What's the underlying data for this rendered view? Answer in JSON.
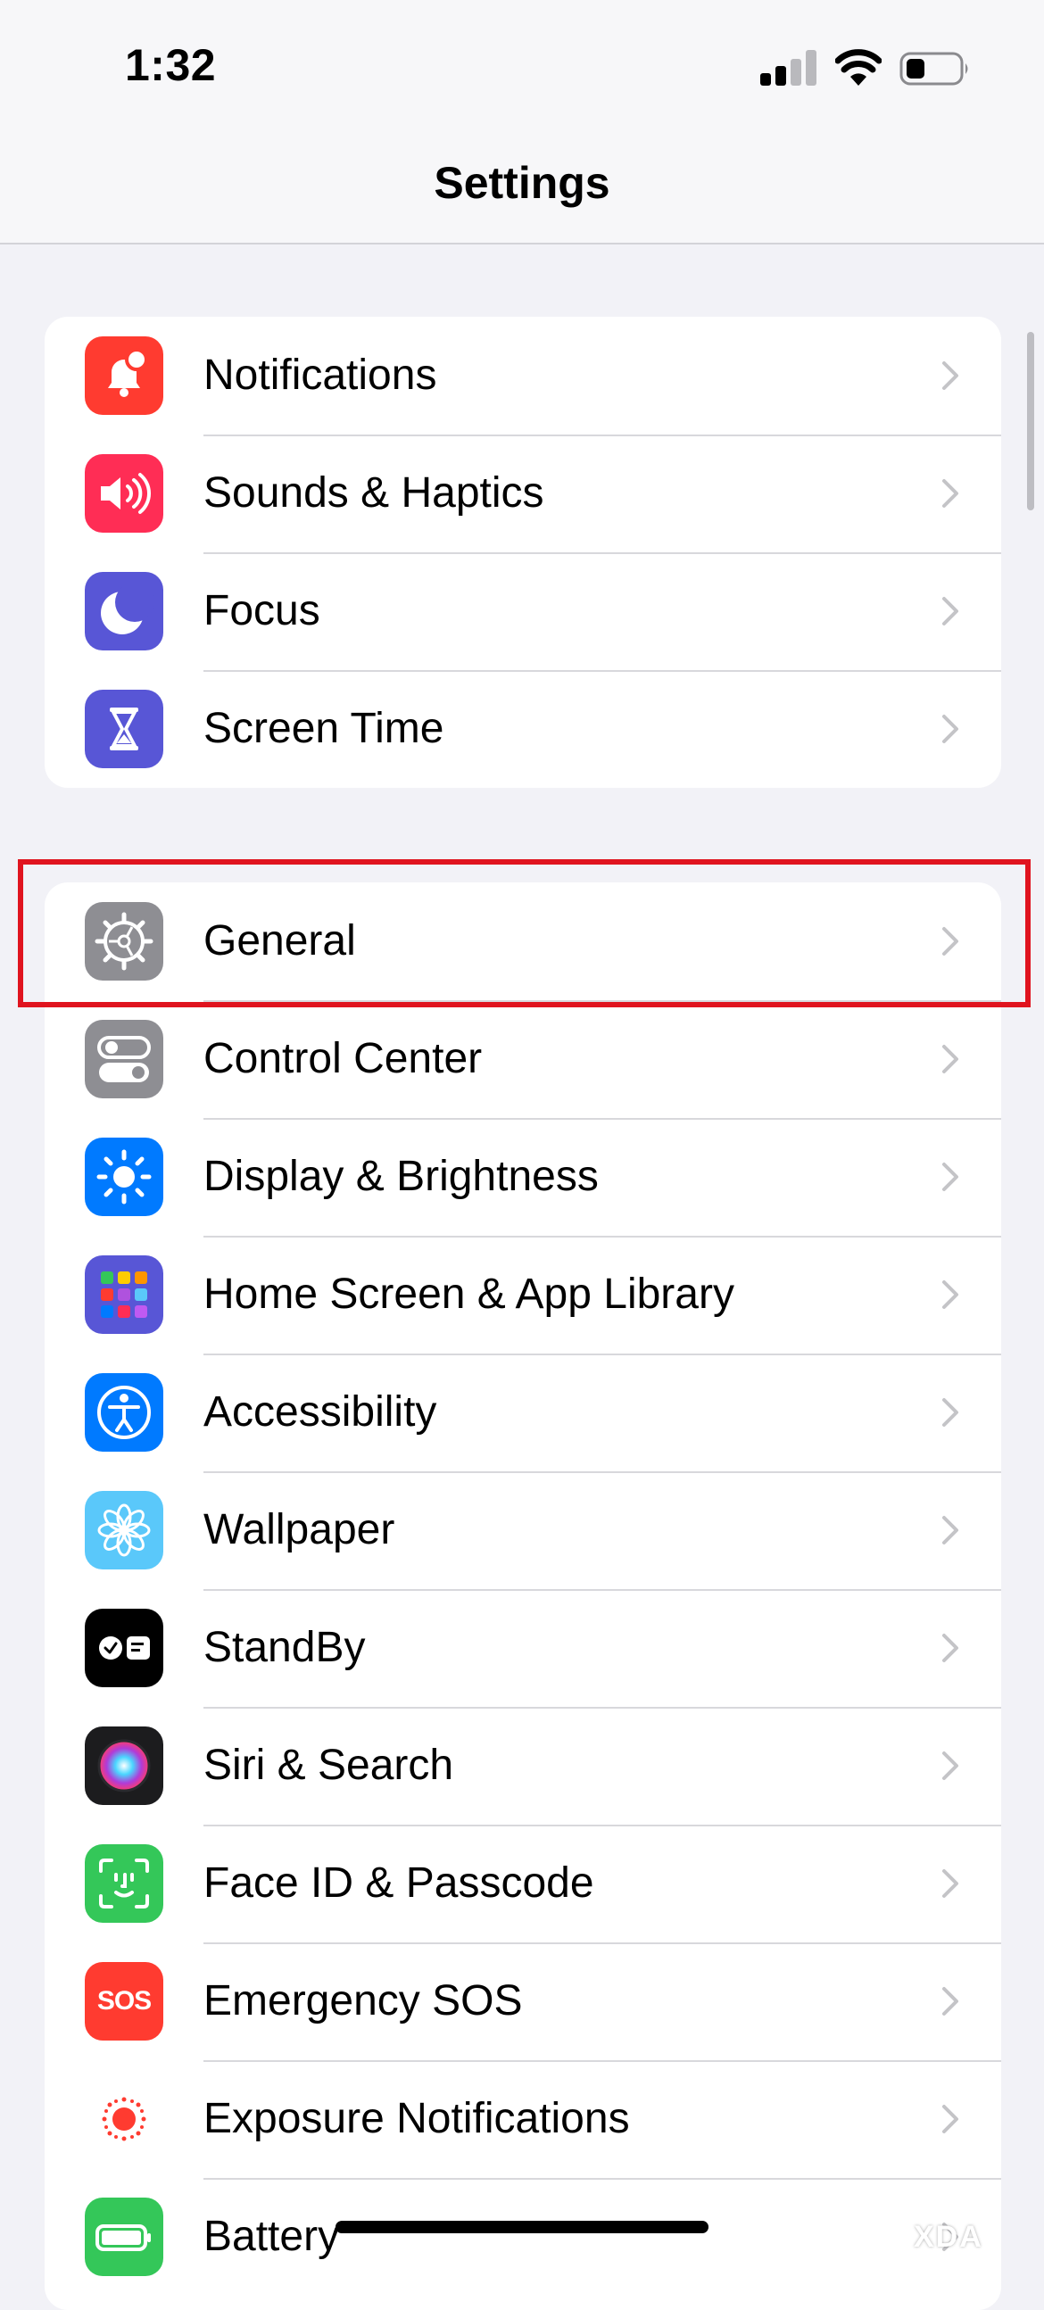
{
  "status_bar": {
    "time": "1:32",
    "signal_bars": 2,
    "battery_level": 0.35
  },
  "nav": {
    "title": "Settings"
  },
  "groups": [
    {
      "items": [
        {
          "label": "Notifications",
          "icon": "notifications-bell-icon",
          "color": "#ff3b30"
        },
        {
          "label": "Sounds & Haptics",
          "icon": "speaker-icon",
          "color": "#ff2d55"
        },
        {
          "label": "Focus",
          "icon": "moon-icon",
          "color": "#5856d6"
        },
        {
          "label": "Screen Time",
          "icon": "hourglass-icon",
          "color": "#5856d6"
        }
      ]
    },
    {
      "items": [
        {
          "label": "General",
          "icon": "gear-icon",
          "color": "#8e8e93",
          "highlighted": true
        },
        {
          "label": "Control Center",
          "icon": "toggles-icon",
          "color": "#8e8e93"
        },
        {
          "label": "Display & Brightness",
          "icon": "sun-icon",
          "color": "#007aff"
        },
        {
          "label": "Home Screen & App Library",
          "icon": "app-grid-icon",
          "color": "#5856d6"
        },
        {
          "label": "Accessibility",
          "icon": "accessibility-person-icon",
          "color": "#007aff"
        },
        {
          "label": "Wallpaper",
          "icon": "flower-icon",
          "color": "#5ac8fa"
        },
        {
          "label": "StandBy",
          "icon": "standby-clock-icon",
          "color": "#000000"
        },
        {
          "label": "Siri & Search",
          "icon": "siri-orb-icon",
          "color": "#1c1c1e"
        },
        {
          "label": "Face ID & Passcode",
          "icon": "face-id-icon",
          "color": "#34c759"
        },
        {
          "label": "Emergency SOS",
          "icon": "sos-icon",
          "color": "#ff3b30",
          "icon_text": "SOS"
        },
        {
          "label": "Exposure Notifications",
          "icon": "exposure-dot-icon",
          "color": "#ffffff"
        },
        {
          "label": "Battery",
          "icon": "battery-icon",
          "color": "#34c759"
        }
      ]
    }
  ],
  "watermark": "XDA",
  "colors": {
    "highlight": "#e0141f",
    "background": "#f2f2f7"
  }
}
